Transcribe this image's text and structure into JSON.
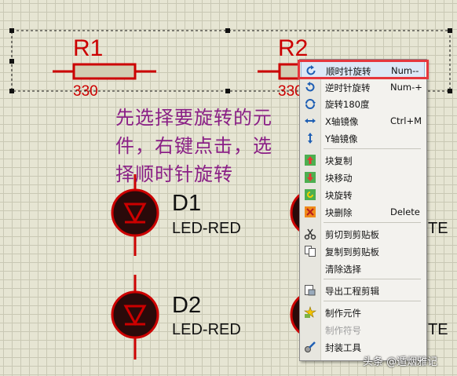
{
  "schematic": {
    "resistors": [
      {
        "ref": "R1",
        "value": "330"
      },
      {
        "ref": "R2",
        "value": "330"
      }
    ],
    "leds": [
      {
        "ref": "D1",
        "value": "LED-RED"
      },
      {
        "ref": "D2",
        "value": "LED-RED"
      }
    ],
    "clipped_labels": [
      "TE",
      "TE"
    ]
  },
  "annotation": {
    "line1": "先选择要旋转的元",
    "line2": "件，右键点击，选",
    "line3": "择顺时针旋转"
  },
  "context_menu": {
    "items": [
      {
        "label": "顺时针旋转",
        "shortcut": "Num--",
        "icon": "rotate-clockwise-icon",
        "highlighted": true
      },
      {
        "label": "逆时针旋转",
        "shortcut": "Num-+",
        "icon": "rotate-counterclockwise-icon"
      },
      {
        "label": "旋转180度",
        "shortcut": "",
        "icon": "rotate-180-icon"
      },
      {
        "label": "X轴镜像",
        "shortcut": "Ctrl+M",
        "icon": "mirror-x-icon"
      },
      {
        "label": "Y轴镜像",
        "shortcut": "",
        "icon": "mirror-y-icon"
      },
      {
        "label": "块复制",
        "shortcut": "",
        "icon": "block-copy-icon"
      },
      {
        "label": "块移动",
        "shortcut": "",
        "icon": "block-move-icon"
      },
      {
        "label": "块旋转",
        "shortcut": "",
        "icon": "block-rotate-icon"
      },
      {
        "label": "块删除",
        "shortcut": "Delete",
        "icon": "block-delete-icon"
      },
      {
        "label": "剪切到剪贴板",
        "shortcut": "",
        "icon": "scissors-icon"
      },
      {
        "label": "复制到剪贴板",
        "shortcut": "",
        "icon": "copy-icon"
      },
      {
        "label": "清除选择",
        "shortcut": "",
        "icon": ""
      },
      {
        "label": "导出工程剪辑",
        "shortcut": "",
        "icon": "export-icon"
      },
      {
        "label": "制作元件",
        "shortcut": "",
        "icon": "make-device-icon"
      },
      {
        "label": "制作符号",
        "shortcut": "",
        "icon": "",
        "disabled": true
      },
      {
        "label": "封装工具",
        "shortcut": "",
        "icon": "package-tool-icon"
      }
    ]
  },
  "watermark": "头条 @遁烟雅记",
  "colors": {
    "background": "#e6e5d3",
    "grid": "#c9c8b4",
    "component_red": "#cc0000",
    "resistor_body": "#d2cdb2",
    "led_fill": "#2a0a0a",
    "annotation_text": "#8a1f86",
    "menu_bg": "#f3f2ee",
    "highlight_border": "#e5373d"
  }
}
